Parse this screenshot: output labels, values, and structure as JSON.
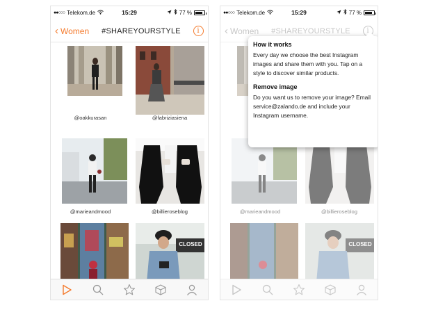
{
  "status_bar": {
    "signal": "●●○○○",
    "carrier": "Telekom.de",
    "time": "15:29",
    "battery": "77 %"
  },
  "nav": {
    "back_label": "Women",
    "title": "#SHAREYOURSTYLE",
    "info_glyph": "i"
  },
  "grid": {
    "items": [
      {
        "handle": "@oakkurasan"
      },
      {
        "handle": "@fabriziasiena"
      },
      {
        "handle": "@marieandmood"
      },
      {
        "handle": "@billieroseblog"
      },
      {
        "handle": ""
      },
      {
        "handle": ""
      }
    ],
    "sign_text": "CLOSED"
  },
  "popover": {
    "how_title": "How it works",
    "how_text": "Every day we choose the best Instagram images and share them with you. Tap on a style to discover similar products.",
    "remove_title": "Remove image",
    "remove_text": "Do you want us to remove your image? Email service@zalando.de and include your Instagram username."
  },
  "tabbar": {
    "icons": [
      "play-icon",
      "search-icon",
      "star-icon",
      "box-icon",
      "profile-icon"
    ]
  },
  "colors": {
    "accent": "#f47a2c",
    "inactive": "#999999"
  }
}
